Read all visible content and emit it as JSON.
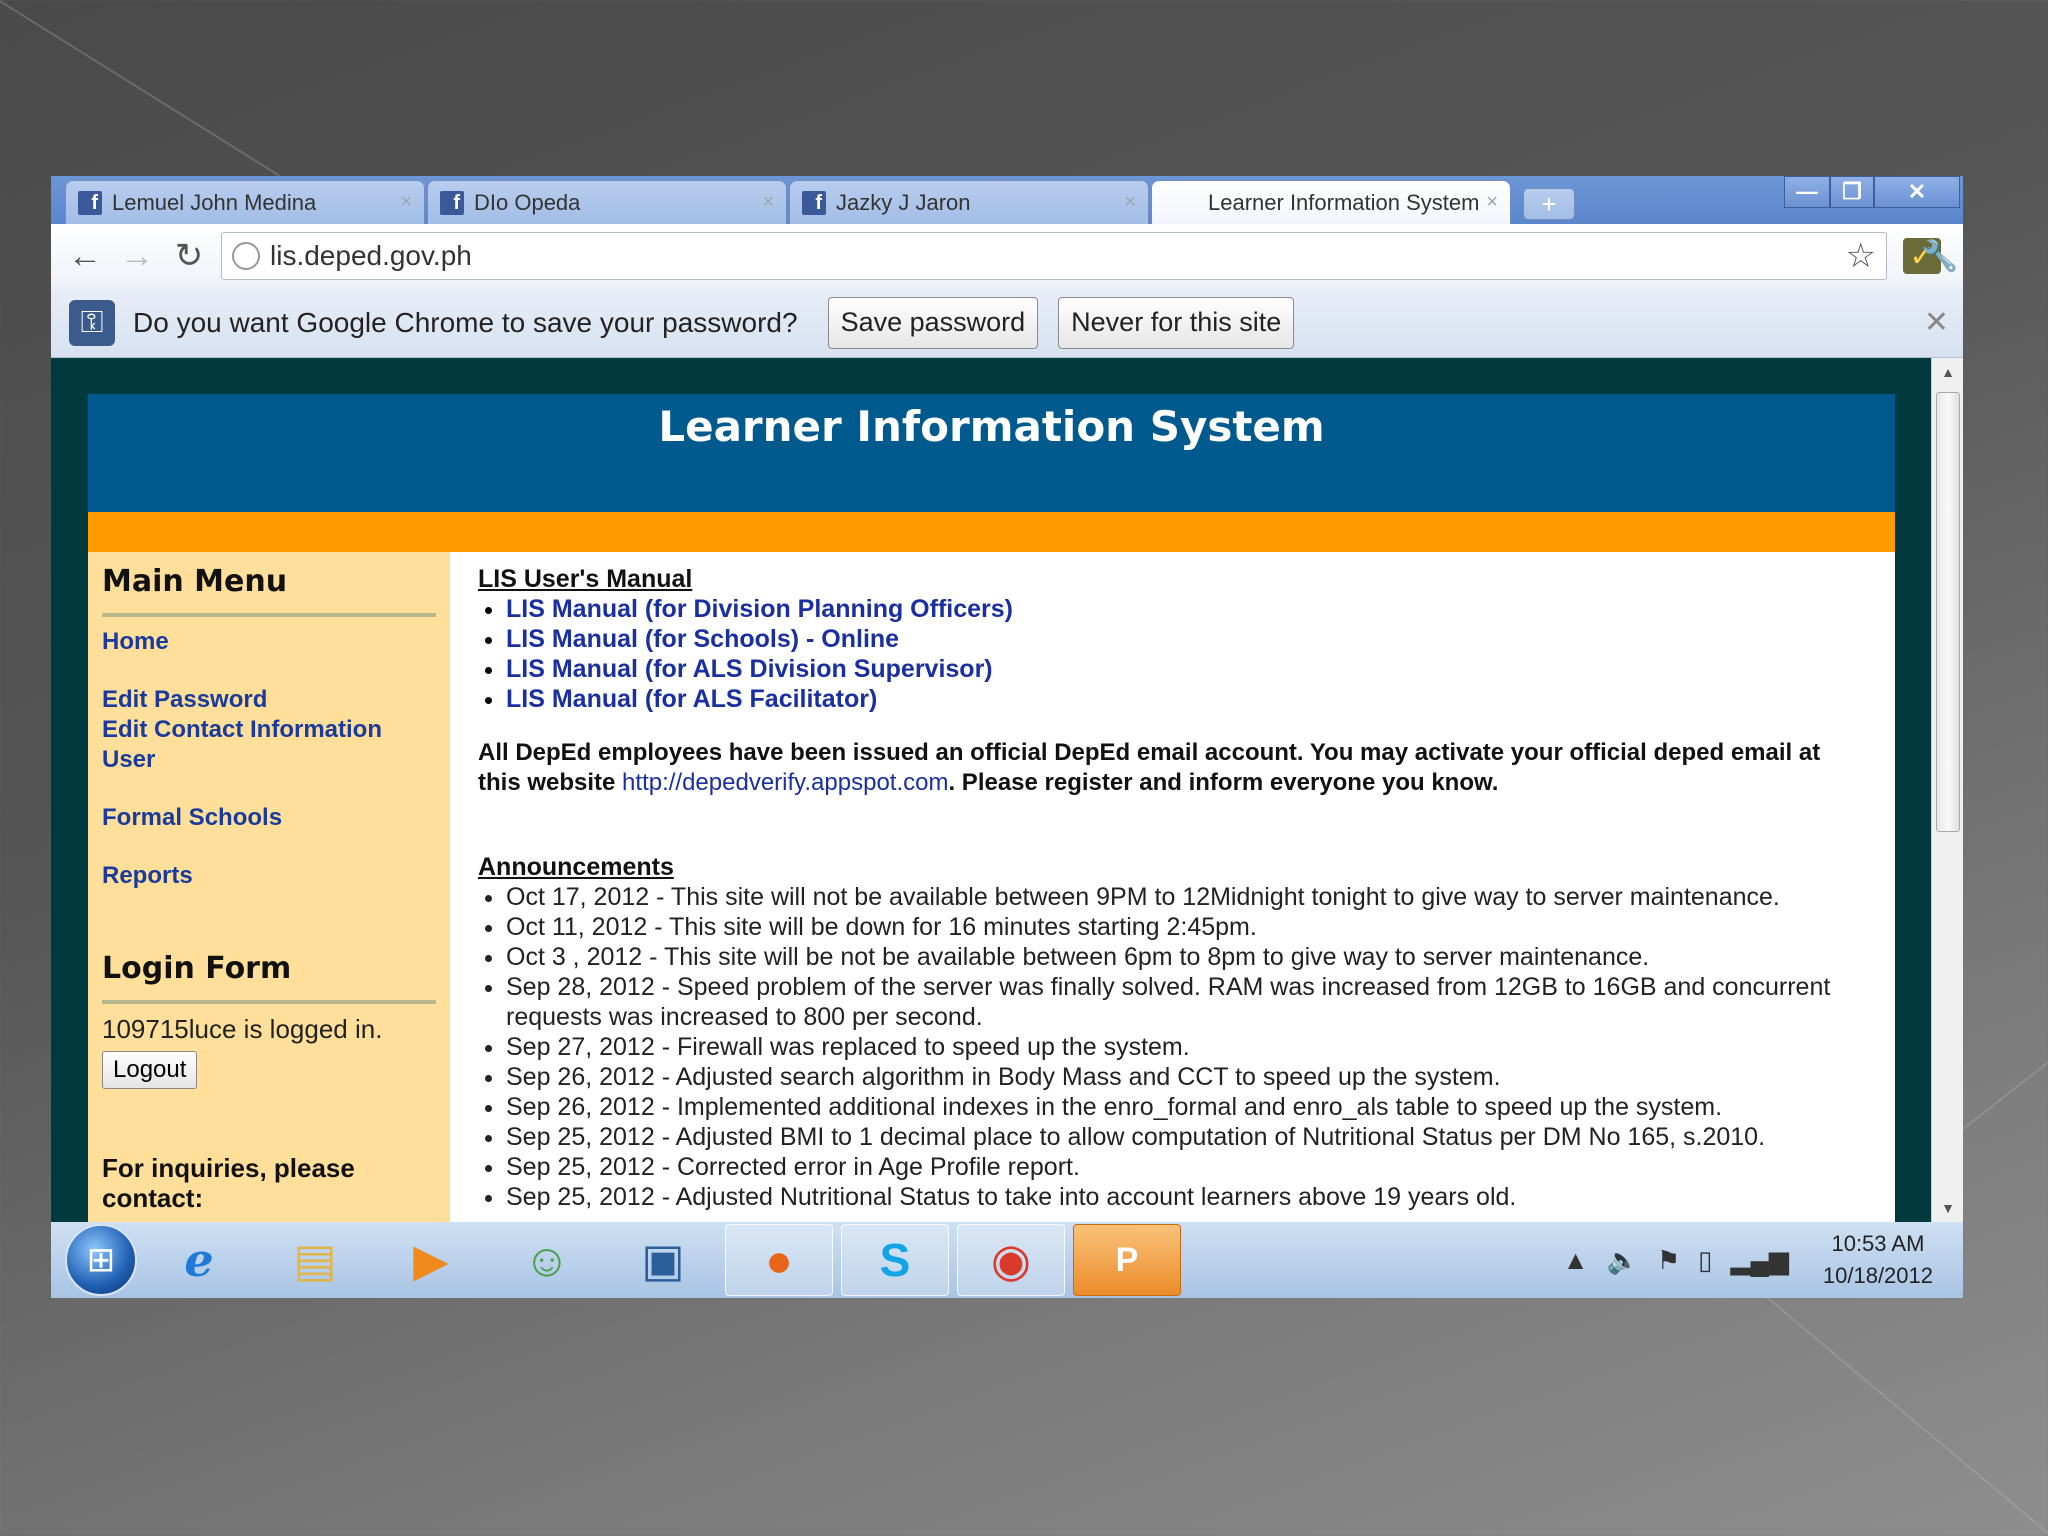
{
  "browser": {
    "tabs": [
      {
        "title": "Lemuel John Medina",
        "icon": "facebook-icon"
      },
      {
        "title": "DIo Opeda",
        "icon": "facebook-icon"
      },
      {
        "title": "Jazky J Jaron",
        "icon": "facebook-icon"
      },
      {
        "title": "Learner Information System",
        "icon": "none"
      }
    ],
    "url": "lis.deped.gov.ph",
    "infobar": {
      "message": "Do you want Google Chrome to save your password?",
      "save_label": "Save password",
      "never_label": "Never for this site"
    }
  },
  "page": {
    "header_title": "Learner Information System",
    "sidebar": {
      "menu_title": "Main Menu",
      "links": [
        "Home",
        "Edit Password",
        "Edit Contact Information",
        "User",
        "Formal Schools",
        "Reports"
      ],
      "login_title": "Login Form",
      "logged_in_text": "109715luce is logged in.",
      "logout_label": "Logout",
      "inquiries_text": "For inquiries, please contact:"
    },
    "content": {
      "manual_title": "LIS User's Manual",
      "manuals": [
        "LIS Manual (for Division Planning Officers)",
        "LIS Manual (for Schools)",
        "LIS Manual (for ALS Division Supervisor)",
        "LIS Manual (for ALS Facilitator)"
      ],
      "manual_online_suffix": " - Online",
      "notice_part1": "All DepEd employees have been issued an official DepEd email account. You may activate your official deped email at this website ",
      "notice_link": "http://depedverify.appspot.com",
      "notice_part2": ". Please register and inform everyone you know.",
      "announcements_title": "Announcements",
      "announcements": [
        "Oct 17, 2012 - This site will not be available between 9PM to 12Midnight tonight to give way to server maintenance.",
        "Oct 11, 2012 - This site will be down for 16 minutes starting 2:45pm.",
        "Oct 3 , 2012 - This site will be not be available between 6pm to 8pm to give way to server maintenance.",
        "Sep 28, 2012 - Speed problem of the server was finally solved. RAM was increased from 12GB to 16GB and concurrent requests was increased to 800 per second.",
        "Sep 27, 2012 - Firewall was replaced to speed up the system.",
        "Sep 26, 2012 - Adjusted search algorithm in Body Mass and CCT to speed up the system.",
        "Sep 26, 2012 - Implemented additional indexes in the enro_formal and enro_als table to speed up the system.",
        "Sep 25, 2012 - Adjusted BMI to 1 decimal place to allow computation of Nutritional Status per DM No 165, s.2010.",
        "Sep 25, 2012 - Corrected error in Age Profile report.",
        "Sep 25, 2012 - Adjusted Nutritional Status to take into account learners above 19 years old."
      ]
    }
  },
  "taskbar": {
    "icons": [
      "internet-explorer-icon",
      "file-explorer-icon",
      "media-player-icon",
      "messenger-icon",
      "briefcase-icon",
      "firefox-icon",
      "skype-icon",
      "chrome-icon",
      "powerpoint-icon"
    ],
    "time": "10:53 AM",
    "date": "10/18/2012"
  },
  "colors": {
    "header_blue": "#005a8e",
    "orange_bar": "#ff9900",
    "sidebar_bg": "#ffdf99",
    "page_bg": "#003a3f",
    "link": "#1a2fa0"
  }
}
